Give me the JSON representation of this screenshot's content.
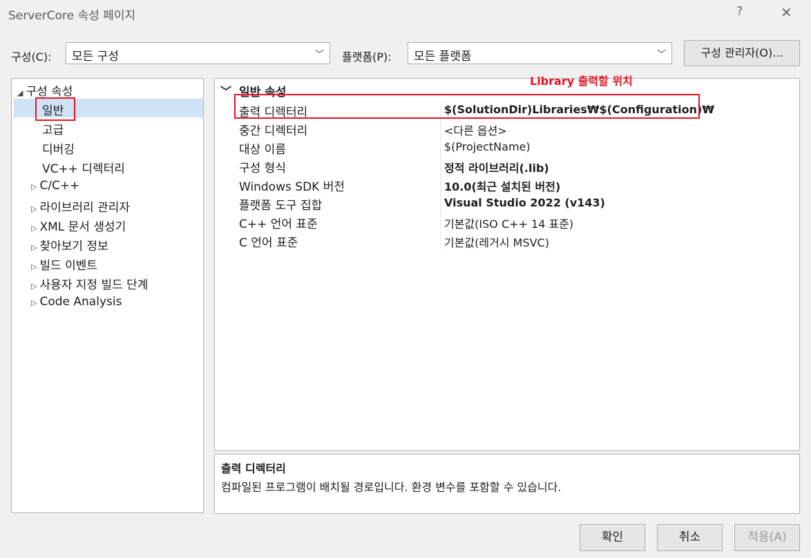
{
  "window": {
    "title": "ServerCore 속성 페이지",
    "help": "?",
    "close": "✕"
  },
  "toolbar": {
    "config_label": "구성(C):",
    "config_value": "모든 구성",
    "platform_label": "플랫폼(P):",
    "platform_value": "모든 플랫폼",
    "manager_label": "구성 관리자(O)..."
  },
  "tree": {
    "root": "구성 속성",
    "items": [
      "일반",
      "고급",
      "디버깅",
      "VC++ 디렉터리"
    ],
    "collapsed": [
      "C/C++",
      "라이브러리 관리자",
      "XML 문서 생성기",
      "찾아보기 정보",
      "빌드 이벤트",
      "사용자 지정 빌드 단계",
      "Code Analysis"
    ]
  },
  "grid": {
    "section": "일반 속성",
    "rows": [
      {
        "name": "출력 디렉터리",
        "value": "$(SolutionDir)Libraries₩$(Configuration)₩",
        "bold": true
      },
      {
        "name": "중간 디렉터리",
        "value": "<다른 옵션>",
        "bold": false
      },
      {
        "name": "대상 이름",
        "value": "$(ProjectName)",
        "bold": false
      },
      {
        "name": "구성 형식",
        "value": "정적 라이브러리(.lib)",
        "bold": true
      },
      {
        "name": "Windows SDK 버전",
        "value": "10.0(최근 설치된 버전)",
        "bold": true
      },
      {
        "name": "플랫폼 도구 집합",
        "value": "Visual Studio 2022 (v143)",
        "bold": true
      },
      {
        "name": "C++ 언어 표준",
        "value": "기본값(ISO C++ 14 표준)",
        "bold": false
      },
      {
        "name": "C 언어 표준",
        "value": "기본값(레거시 MSVC)",
        "bold": false
      }
    ]
  },
  "annotation": "Library 출력할 위치",
  "description": {
    "title": "출력 디렉터리",
    "text": "컴파일된 프로그램이 배치될 경로입니다. 환경 변수를 포함할 수 있습니다."
  },
  "footer": {
    "ok": "확인",
    "cancel": "취소",
    "apply": "적용(A)"
  },
  "colors": {
    "selection": "#cfe2f6",
    "annotation": "#e81123"
  }
}
